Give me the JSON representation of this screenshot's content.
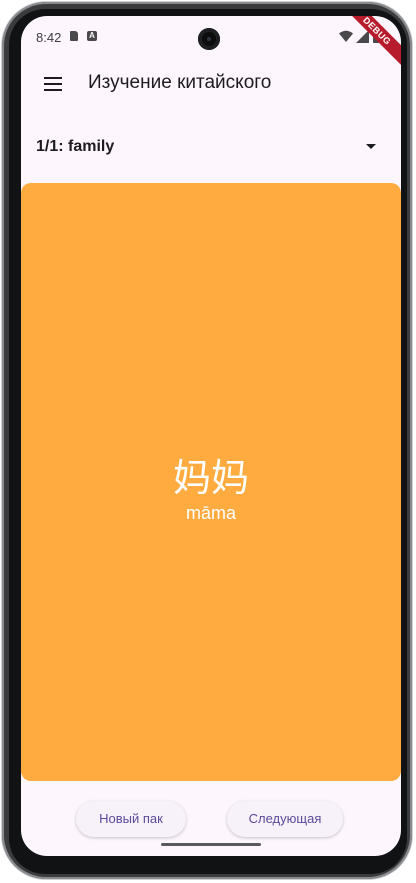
{
  "status_bar": {
    "time": "8:42",
    "notification_badge": "A",
    "debug_banner": "DEBUG"
  },
  "app_bar": {
    "title": "Изучение китайского",
    "menu_icon": "hamburger-menu-icon"
  },
  "deck_selector": {
    "selected": "1/1: family"
  },
  "card": {
    "hanzi": "妈妈",
    "pinyin": "māma",
    "background_color": "#ffab40"
  },
  "actions": {
    "new_pack_label": "Новый пак",
    "next_label": "Следующая"
  },
  "colors": {
    "screen_bg": "#fdf7fd",
    "button_text": "#5a4a9a"
  }
}
